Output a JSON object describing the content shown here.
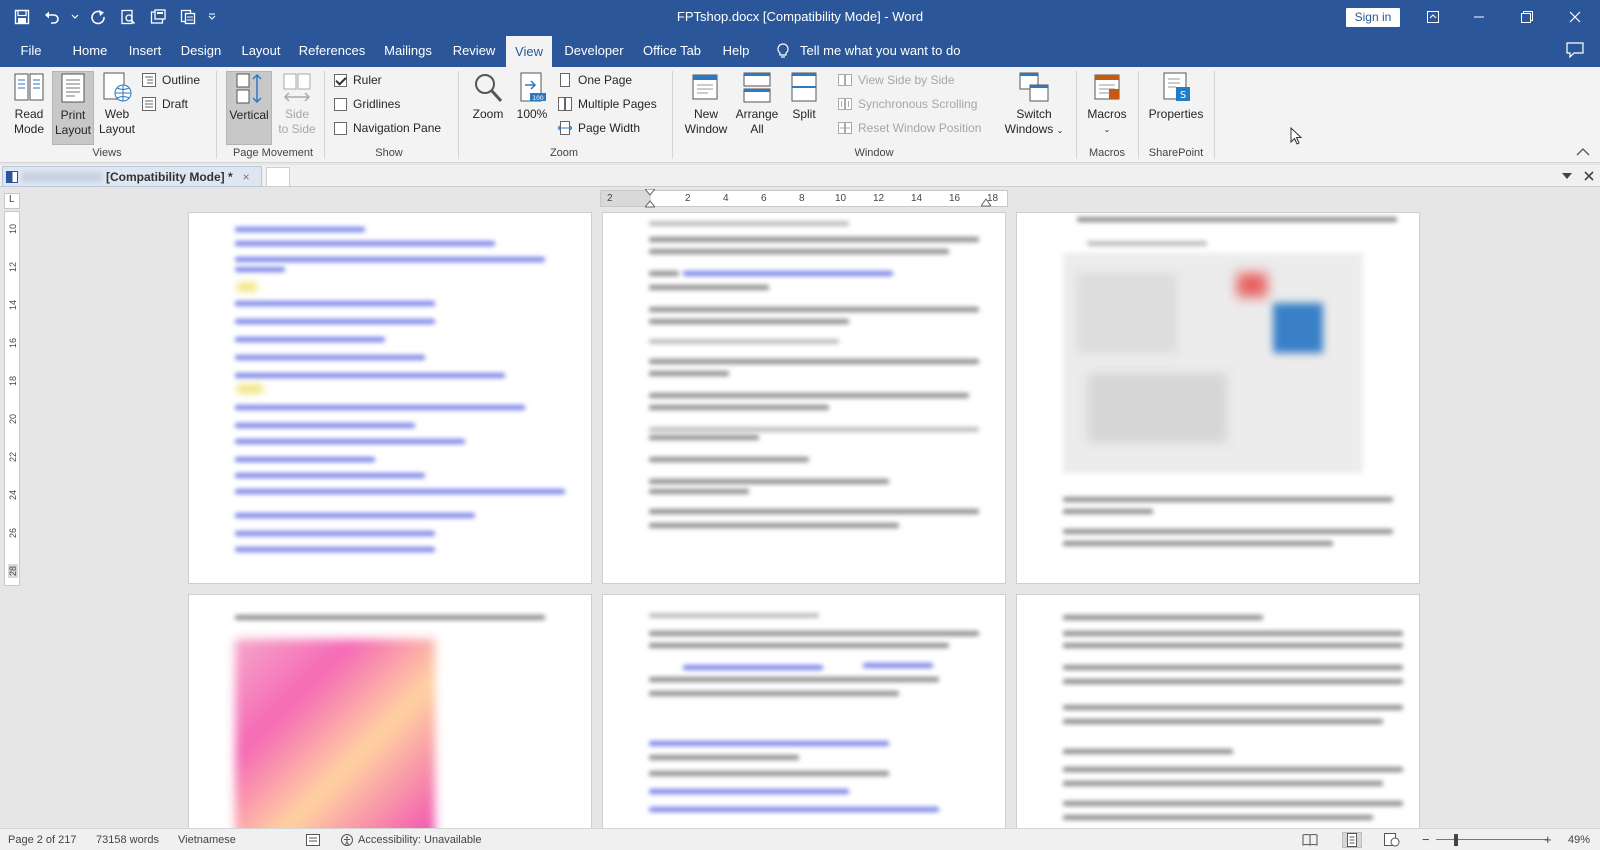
{
  "window": {
    "title": "FPTshop.docx [Compatibility Mode] - Word",
    "sign_in": "Sign in"
  },
  "quick_access": [
    "save-icon",
    "undo-icon",
    "redo-icon",
    "print-preview-icon",
    "save-as-icon",
    "copy-format-icon",
    "customize-qat-icon"
  ],
  "tabs": [
    "File",
    "Home",
    "Insert",
    "Design",
    "Layout",
    "References",
    "Mailings",
    "Review",
    "View",
    "Developer",
    "Office Tab",
    "Help"
  ],
  "active_tab": "View",
  "tell_me": "Tell me what you want to do",
  "ribbon": {
    "views": {
      "label": "Views",
      "read_mode": "Read Mode",
      "read_mode_l1": "Read",
      "read_mode_l2": "Mode",
      "print_layout_l1": "Print",
      "print_layout_l2": "Layout",
      "web_layout_l1": "Web",
      "web_layout_l2": "Layout",
      "outline": "Outline",
      "draft": "Draft"
    },
    "page_movement": {
      "label": "Page Movement",
      "vertical": "Vertical",
      "side_l1": "Side",
      "side_l2": "to Side"
    },
    "show": {
      "label": "Show",
      "ruler": "Ruler",
      "ruler_checked": true,
      "gridlines": "Gridlines",
      "gridlines_checked": false,
      "navigation_pane": "Navigation Pane",
      "navigation_pane_checked": false
    },
    "zoom": {
      "label": "Zoom",
      "zoom": "Zoom",
      "hundred": "100%",
      "one_page": "One Page",
      "multiple_pages": "Multiple Pages",
      "page_width": "Page Width"
    },
    "window": {
      "label": "Window",
      "new_l1": "New",
      "new_l2": "Window",
      "arrange_l1": "Arrange",
      "arrange_l2": "All",
      "split": "Split",
      "view_side_by_side": "View Side by Side",
      "synchronous_scrolling": "Synchronous Scrolling",
      "reset_window_position": "Reset Window Position",
      "switch_l1": "Switch",
      "switch_l2": "Windows"
    },
    "macros": {
      "label": "Macros",
      "macros": "Macros"
    },
    "sharepoint": {
      "label": "SharePoint",
      "properties": "Properties"
    }
  },
  "doc_tab": {
    "label": "[Compatibility Mode] *",
    "close": "×"
  },
  "ruler": {
    "h_ticks": [
      "2",
      "2",
      "4",
      "6",
      "8",
      "10",
      "12",
      "14",
      "16",
      "18"
    ],
    "v_ticks": [
      "10",
      "12",
      "14",
      "16",
      "18",
      "20",
      "22",
      "24",
      "26",
      "28"
    ],
    "corner": "L"
  },
  "status": {
    "page": "Page 2 of 217",
    "words": "73158 words",
    "language": "Vietnamese",
    "accessibility": "Accessibility: Unavailable",
    "zoom_minus": "−",
    "zoom_plus": "+",
    "zoom_level": "49%"
  },
  "colors": {
    "title_bar": "#2b579a",
    "ribbon": "#f3f3f3",
    "workspace": "#e6e6e6"
  }
}
